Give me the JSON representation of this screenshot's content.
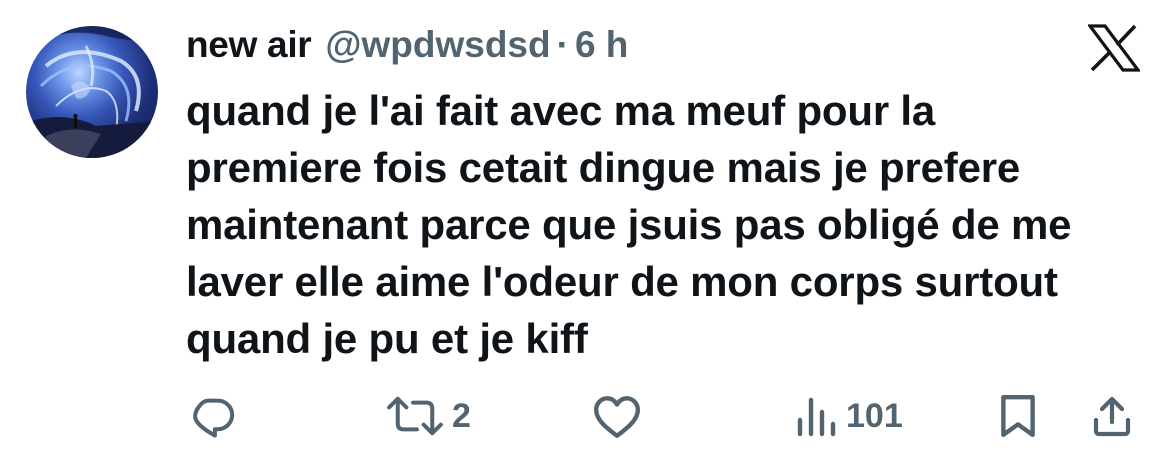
{
  "tweet": {
    "author": {
      "display_name": "new air",
      "handle": "@wpdwsdsd",
      "separator": "·",
      "time": "6 h"
    },
    "text": "quand je l'ai fait avec ma meuf pour la\npremiere fois cetait dingue mais je prefere\nmaintenant parce que jsuis pas obligé de me\nlaver elle aime l'odeur de mon corps surtout\nquand je pu et je kiff",
    "actions": {
      "reply_icon": "reply-icon",
      "retweet_icon": "retweet-icon",
      "retweet_count": "2",
      "like_icon": "heart-icon",
      "views_icon": "views-icon",
      "views_count": "101",
      "bookmark_icon": "bookmark-icon",
      "share_icon": "share-icon"
    }
  },
  "brand": {
    "logo": "x-logo",
    "text_color": "#0f1419",
    "muted_color": "#536471"
  }
}
